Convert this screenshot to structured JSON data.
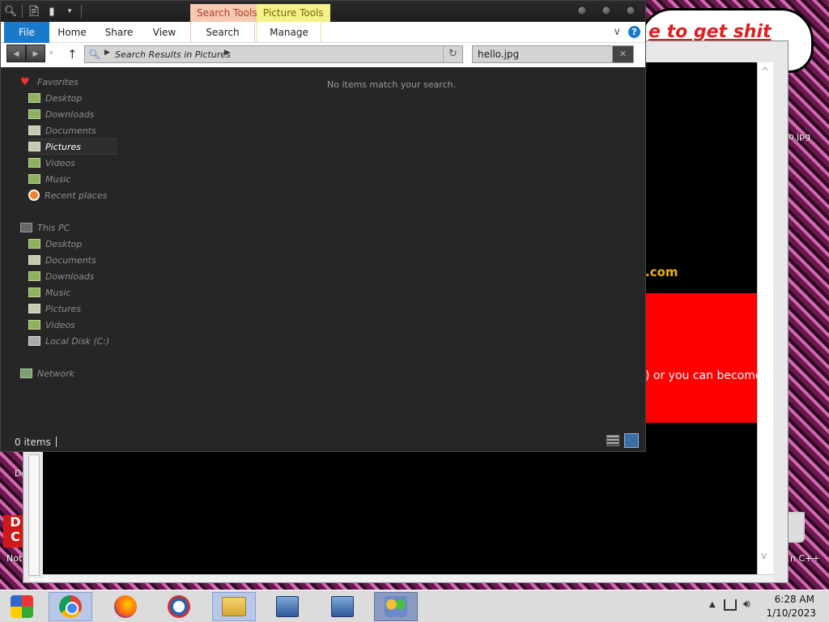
{
  "background_window": {
    "com_text": ".com",
    "red_box_text": ") or you can become",
    "speech_bubble_text": "e to get shit",
    "speech_bubble_tail": "te",
    "scroll_chevron_up": "^",
    "scroll_chevron_down": "v"
  },
  "desktop_labels": {
    "left_top": "Dc",
    "left_bottom": "Not",
    "right_top": "o.jpg",
    "right_bottom": "n C++",
    "dc_block": "D C"
  },
  "explorer": {
    "context_tabs": {
      "search_tools": "Search Tools",
      "picture_tools": "Picture Tools"
    },
    "ribbon_tabs": {
      "file": "File",
      "home": "Home",
      "share": "Share",
      "view": "View",
      "search": "Search",
      "manage": "Manage"
    },
    "help": "?",
    "address": {
      "path": "Search Results in Pictures"
    },
    "search": {
      "value": "hello.jpg",
      "clear": "✕"
    },
    "empty_message": "No items match your search.",
    "status": {
      "count": "0 items"
    },
    "nav": {
      "favorites": "Favorites",
      "fav_items": [
        "Desktop",
        "Downloads",
        "Documents",
        "Pictures",
        "Videos",
        "Music",
        "Recent places"
      ],
      "this_pc": "This PC",
      "pc_items": [
        "Desktop",
        "Documents",
        "Downloads",
        "Music",
        "Pictures",
        "Videos",
        "Local Disk (C:)"
      ],
      "network": "Network"
    }
  },
  "taskbar": {
    "items": [
      "start",
      "chrome",
      "firefox",
      "obama",
      "file-explorer",
      "network-pc",
      "network-pc-2",
      "people"
    ],
    "time": "6:28 AM",
    "date": "1/10/2023"
  }
}
